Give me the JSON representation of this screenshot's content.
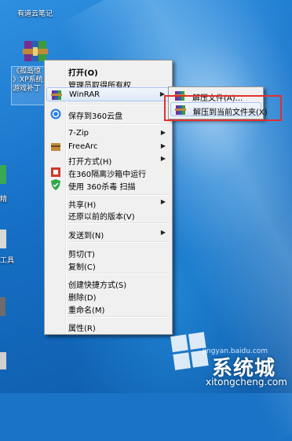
{
  "desktop": {
    "youdao_label": "有道云笔记",
    "archive_label_lines": [
      "《孤岛惊",
      "》XP系统",
      "游戏补丁"
    ],
    "left_edge_labels": [
      "精",
      "工具"
    ],
    "watermark_brand": "系统城",
    "watermark_url": "xitongcheng.com",
    "watermark_small": "jingyan.baidu.com"
  },
  "context_menu": {
    "items": [
      {
        "label": "打开(O)",
        "bold": true
      },
      {
        "label": "管理员取得所有权"
      },
      {
        "label": "WinRAR",
        "icon": "winrar-icon",
        "submenu": true
      },
      {
        "label": "保存到360云盘",
        "icon": "cloud-360-icon"
      },
      {
        "label": "7-Zip",
        "submenu": true
      },
      {
        "label": "FreeArc",
        "icon": "freearc-icon",
        "submenu": true
      },
      {
        "label": "打开方式(H)",
        "submenu": true
      },
      {
        "label": "在360隔离沙箱中运行",
        "icon": "sandbox-icon"
      },
      {
        "label": "使用 360杀毒 扫描",
        "icon": "shield-360-icon"
      },
      {
        "label": "共享(H)",
        "submenu": true
      },
      {
        "label": "还原以前的版本(V)"
      },
      {
        "label": "发送到(N)",
        "submenu": true
      },
      {
        "label": "剪切(T)"
      },
      {
        "label": "复制(C)"
      },
      {
        "label": "创建快捷方式(S)"
      },
      {
        "label": "删除(D)"
      },
      {
        "label": "重命名(M)"
      },
      {
        "label": "属性(R)"
      }
    ]
  },
  "winrar_submenu": {
    "items": [
      {
        "label": "解压文件(A)...",
        "icon": "winrar-icon"
      },
      {
        "label": "解压到当前文件夹(X)",
        "icon": "winrar-icon"
      }
    ]
  },
  "colors": {
    "highlight_border": "#e03030",
    "menu_bg": "#f0f0f0"
  }
}
